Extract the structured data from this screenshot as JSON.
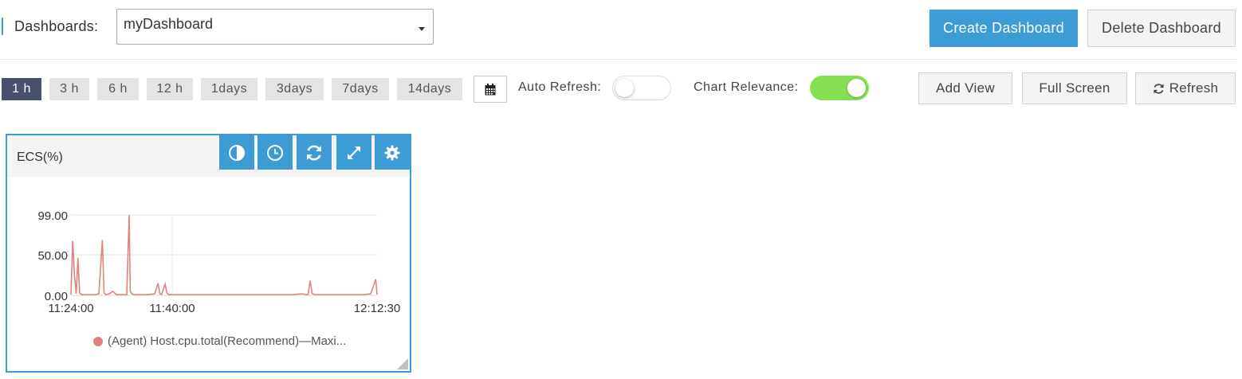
{
  "header": {
    "dashboards_label": "Dashboards:",
    "selected_dashboard": "myDashboard",
    "create_button": "Create Dashboard",
    "delete_button": "Delete Dashboard"
  },
  "toolbar": {
    "time_ranges": [
      "1 h",
      "3 h",
      "6 h",
      "12 h",
      "1days",
      "3days",
      "7days",
      "14days"
    ],
    "active_range": "1 h",
    "auto_refresh_label": "Auto Refresh:",
    "auto_refresh_on": false,
    "chart_relevance_label": "Chart Relevance:",
    "chart_relevance_on": true,
    "add_view_button": "Add View",
    "full_screen_button": "Full Screen",
    "refresh_button": "Refresh"
  },
  "colors": {
    "accent": "#3d9bd6",
    "active_time": "#47516b",
    "toggle_on": "#84df52",
    "series": "#e0837f"
  },
  "widget": {
    "title": "ECS(%)",
    "icons": [
      "contrast-icon",
      "clock-icon",
      "sync-icon",
      "expand-icon",
      "gear-icon"
    ]
  },
  "chart_data": {
    "type": "line",
    "y_tick_labels": [
      "99.00",
      "50.00",
      "0.00"
    ],
    "x_tick_labels": [
      "11:24:00",
      "11:40:00",
      "12:12:30"
    ],
    "ylim": [
      0,
      99
    ],
    "grid": true,
    "legend_position": "bottom",
    "series": [
      {
        "name": "(Agent) Host.cpu.total(Recommend)—Maxi...",
        "color": "#e0837f",
        "points": [
          [
            0,
            1
          ],
          [
            0.5,
            67
          ],
          [
            1,
            25
          ],
          [
            1.5,
            2
          ],
          [
            2,
            46
          ],
          [
            2.5,
            3
          ],
          [
            3,
            1
          ],
          [
            4,
            1
          ],
          [
            5,
            1
          ],
          [
            6,
            1
          ],
          [
            7,
            1
          ],
          [
            8,
            2
          ],
          [
            9,
            68
          ],
          [
            9.5,
            3
          ],
          [
            10,
            1
          ],
          [
            11,
            2
          ],
          [
            12,
            5
          ],
          [
            13,
            1
          ],
          [
            14,
            1
          ],
          [
            15,
            1
          ],
          [
            16,
            1
          ],
          [
            16.7,
            99
          ],
          [
            17,
            5
          ],
          [
            17.5,
            2
          ],
          [
            18,
            1
          ],
          [
            20,
            1
          ],
          [
            22,
            1
          ],
          [
            24,
            2
          ],
          [
            25,
            15
          ],
          [
            25.5,
            2
          ],
          [
            26,
            1
          ],
          [
            27,
            14
          ],
          [
            27.5,
            3
          ],
          [
            28,
            1
          ],
          [
            30,
            1
          ],
          [
            32,
            1
          ],
          [
            34,
            1
          ],
          [
            36,
            1
          ],
          [
            38,
            1
          ],
          [
            40,
            1
          ],
          [
            42,
            1
          ],
          [
            44,
            1
          ],
          [
            46,
            1
          ],
          [
            48,
            1
          ],
          [
            50,
            1
          ],
          [
            52,
            1
          ],
          [
            54,
            1
          ],
          [
            56,
            1
          ],
          [
            58,
            1
          ],
          [
            60,
            1
          ],
          [
            62,
            1
          ],
          [
            64,
            1
          ],
          [
            66,
            2
          ],
          [
            68,
            1
          ],
          [
            68.6,
            18
          ],
          [
            69.2,
            2
          ],
          [
            70,
            1
          ],
          [
            72,
            1
          ],
          [
            74,
            1
          ],
          [
            76,
            1
          ],
          [
            78,
            1
          ],
          [
            80,
            1
          ],
          [
            82,
            1
          ],
          [
            84,
            1
          ],
          [
            86,
            2
          ],
          [
            87.4,
            20
          ],
          [
            87.8,
            1
          ]
        ]
      }
    ]
  }
}
